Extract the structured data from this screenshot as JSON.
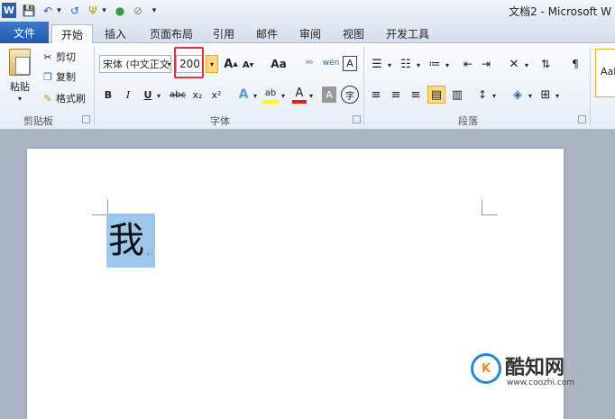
{
  "window": {
    "title": "文档2 - Microsoft W",
    "quick_access": [
      "W",
      "💾",
      "↶",
      "▾",
      "↺",
      "Ψ",
      "▾",
      "●",
      "⊘",
      "▾"
    ]
  },
  "tabs": {
    "file": "文件",
    "items": [
      "开始",
      "插入",
      "页面布局",
      "引用",
      "邮件",
      "审阅",
      "视图",
      "开发工具"
    ]
  },
  "clipboard": {
    "paste_label": "粘贴",
    "cut_label": "剪切",
    "copy_label": "复制",
    "format_painter_label": "格式刷",
    "group_label": "剪贴板"
  },
  "font": {
    "font_name": "宋体 (中文正文",
    "font_size": "200",
    "group_label": "字体",
    "grow": "A",
    "shrink": "A",
    "change_case": "Aa",
    "clear_format": "ᴬᵇ",
    "phonetic": "wén",
    "char_border": "A",
    "bold": "B",
    "italic": "I",
    "underline": "U",
    "strike": "abc",
    "subscript": "x₂",
    "superscript": "x²",
    "text_effect": "A",
    "highlight": "ab",
    "font_color": "A",
    "char_shading": "A",
    "enclose": "字"
  },
  "paragraph": {
    "group_label": "段落"
  },
  "styles": {
    "preview": "AaB"
  },
  "document": {
    "selected_text": "我",
    "para_mark": "↵"
  },
  "watermark": {
    "logo_text": "K",
    "name": "酷知网",
    "url": "www.coozhi.com"
  },
  "colors": {
    "file_tab": "#2a64b8",
    "highlight_box": "#e0323a",
    "selection": "#9ec7ec",
    "active_button": "#ffd97a"
  }
}
